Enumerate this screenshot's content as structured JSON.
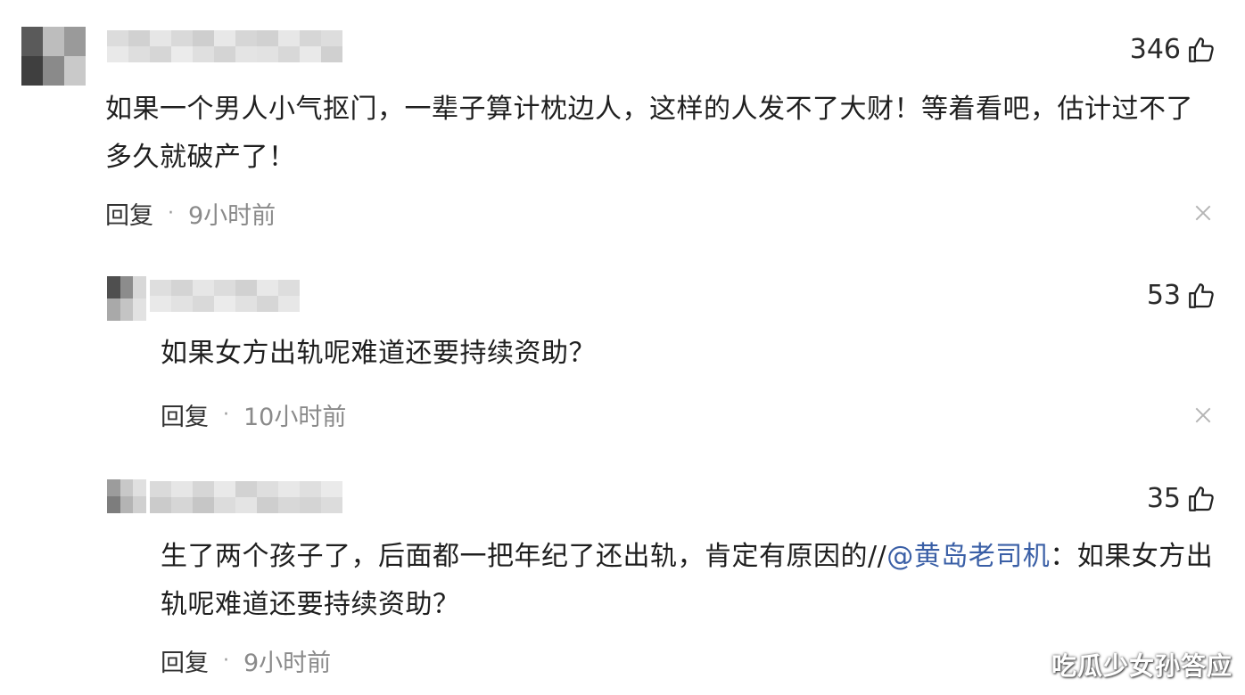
{
  "comments": [
    {
      "likes": "346",
      "text": "如果一个男人小气抠门，一辈子算计枕边人，这样的人发不了大财！等着看吧，估计过不了多久就破产了！",
      "reply_label": "回复",
      "dot": "·",
      "time": "9小时前"
    },
    {
      "likes": "53",
      "text": "如果女方出轨呢难道还要持续资助？",
      "reply_label": "回复",
      "dot": "·",
      "time": "10小时前"
    },
    {
      "likes": "35",
      "text_before": "生了两个孩子了，后面都一把年纪了还出轨，肯定有原因的//",
      "mention": "@黄岛老司机",
      "text_after": "：如果女方出轨呢难道还要持续资助？",
      "reply_label": "回复",
      "dot": "·",
      "time": "9小时前"
    }
  ],
  "watermark": "吃瓜少女孙答应",
  "icons": {
    "like": "thumbs-up-icon",
    "close": "close-icon",
    "avatar": "avatar-mosaic",
    "username": "username-mosaic"
  },
  "colors": {
    "mention": "#3a5fa6",
    "time": "#8a8a8a",
    "close": "#b5b5b5"
  }
}
